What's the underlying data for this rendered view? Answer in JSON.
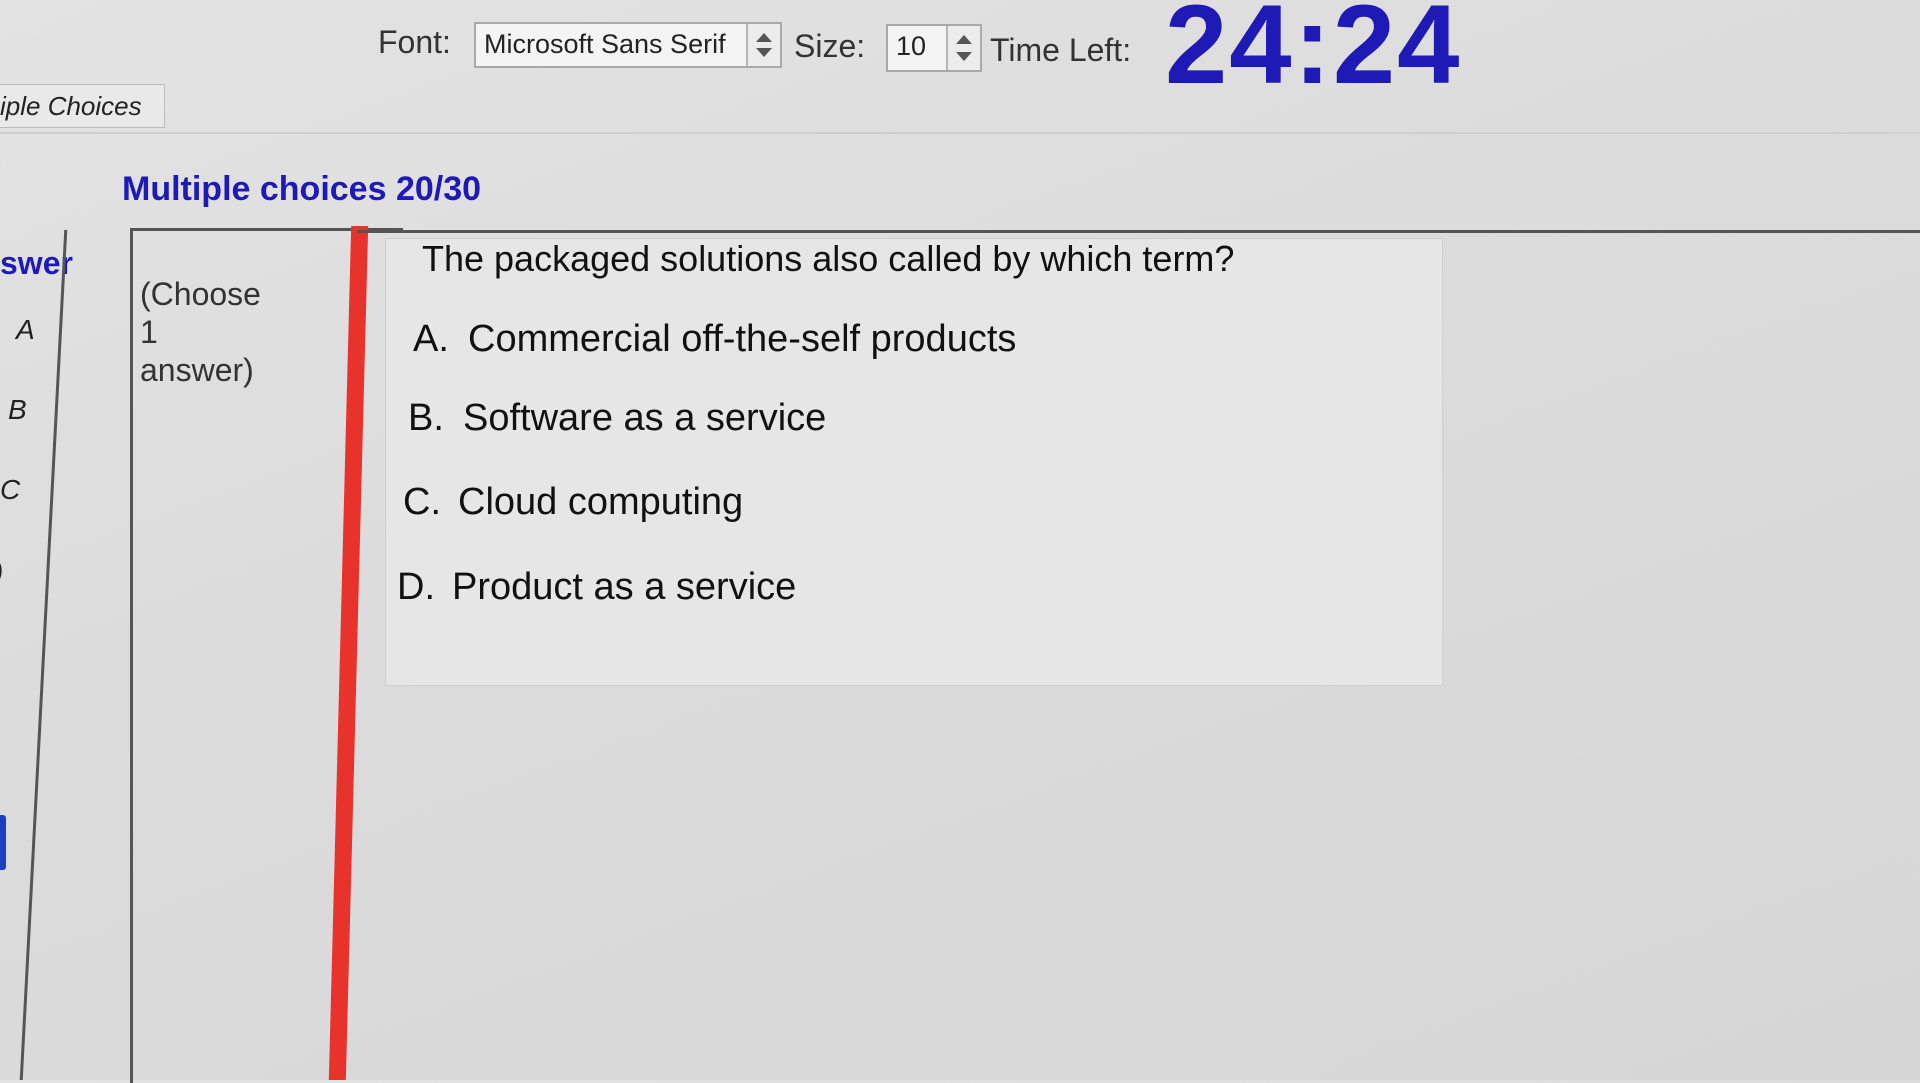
{
  "toolbar": {
    "font_label": "Font:",
    "font_value": "Microsoft Sans Serif",
    "size_label": "Size:",
    "size_value": "10",
    "time_left_label": "Time Left:",
    "time_left_value": "24:24"
  },
  "tab": {
    "label": "iple Choices"
  },
  "section": {
    "title": "Multiple choices 20/30"
  },
  "answer_panel": {
    "header": "swer",
    "letters": [
      "A",
      "B",
      "C",
      ")"
    ]
  },
  "instructions": {
    "line1": "(Choose",
    "line2": "1",
    "line3": "answer)"
  },
  "question": {
    "text": "The packaged solutions also called by which term?",
    "options": [
      {
        "letter": "A.",
        "text": "Commercial off-the-self products"
      },
      {
        "letter": "B.",
        "text": "Software as a service"
      },
      {
        "letter": "C.",
        "text": "Cloud computing"
      },
      {
        "letter": "D.",
        "text": "Product as a service"
      }
    ]
  },
  "colors": {
    "accent_blue": "#1d1ab6",
    "red_bar": "#e8322c"
  }
}
